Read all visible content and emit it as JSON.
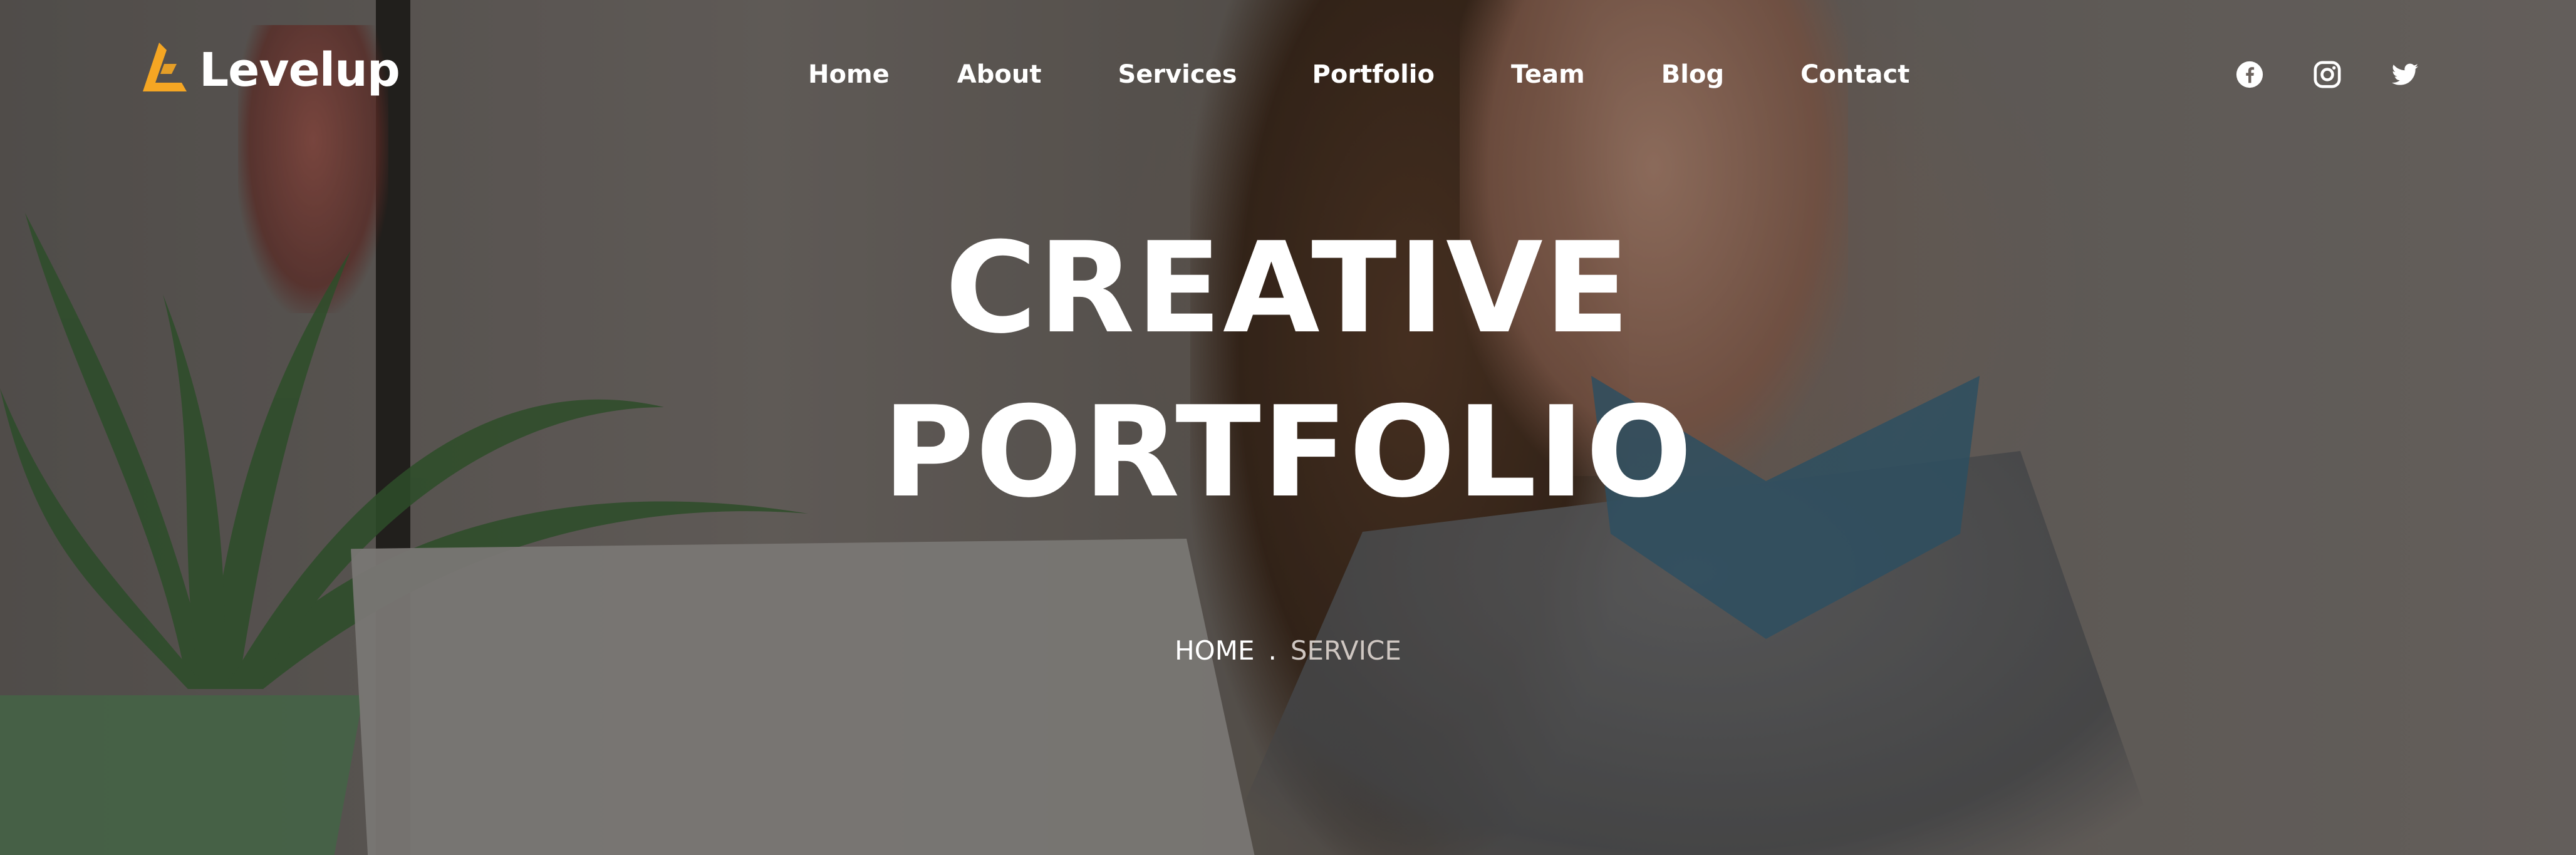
{
  "brand": {
    "name": "Levelup",
    "accent": "#F5A623"
  },
  "nav": {
    "items": [
      {
        "label": "Home"
      },
      {
        "label": "About"
      },
      {
        "label": "Services"
      },
      {
        "label": "Portfolio"
      },
      {
        "label": "Team"
      },
      {
        "label": "Blog"
      },
      {
        "label": "Contact"
      }
    ]
  },
  "social": {
    "icons": [
      "facebook-icon",
      "instagram-icon",
      "twitter-icon"
    ]
  },
  "hero": {
    "title_line1": "CREATIVE",
    "title_line2": "PORTFOLIO"
  },
  "breadcrumb": {
    "home": "HOME",
    "separator": ".",
    "current": "SERVICE"
  }
}
